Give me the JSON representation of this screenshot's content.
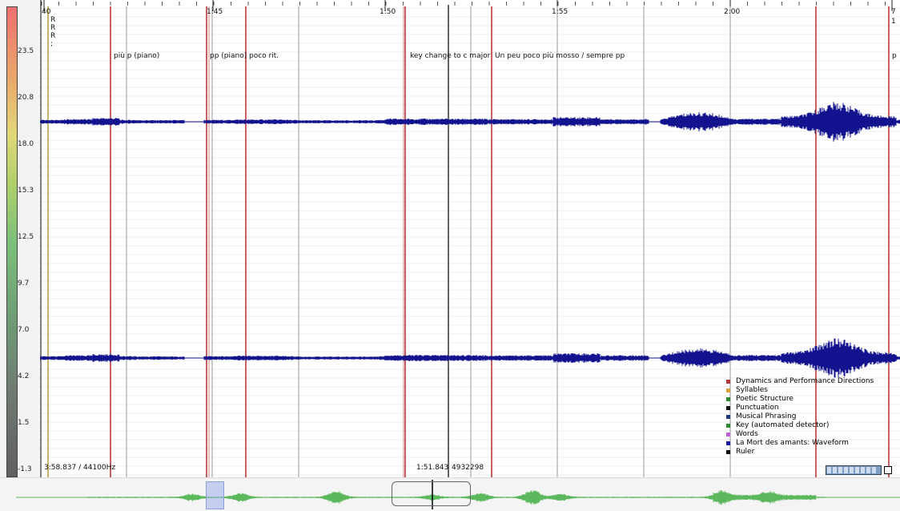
{
  "color_scale": {
    "labels": [
      "23.5",
      "20.8",
      "18.0",
      "15.3",
      "12.5",
      "9.7",
      "7.0",
      "4.2",
      "1.5",
      "-1.3"
    ]
  },
  "ruler": {
    "ticks": [
      "40",
      "1:45",
      "1:50",
      "1:55",
      "2:00",
      "7"
    ],
    "edge_sub_label": "1"
  },
  "annotations": {
    "r_marks": "R\nR\nR\n;",
    "labels": [
      "più p (piano)",
      "pp (piano)",
      "poco rit.",
      "key change to c major",
      "Un peu poco più mosso / sempre pp",
      "p"
    ]
  },
  "status": {
    "duration": "3:58.837 / 44100Hz",
    "cursor_time": "1:51.843",
    "cursor_frame": "4932298"
  },
  "legend": {
    "items": [
      {
        "label": "Dynamics and Performance Directions",
        "color": "#b03a3a"
      },
      {
        "label": "Syllables",
        "color": "#d9a03a"
      },
      {
        "label": "Poetic Structure",
        "color": "#2e8b2e"
      },
      {
        "label": "Punctuation",
        "color": "#111111"
      },
      {
        "label": "Musical Phrasing",
        "color": "#1f3a7a"
      },
      {
        "label": "Key (automated detector)",
        "color": "#2e8b2e"
      },
      {
        "label": "Words",
        "color": "#c060d0"
      },
      {
        "label": "La Mort des amants: Waveform",
        "color": "#1a1aa0"
      },
      {
        "label": "Ruler",
        "color": "#111111"
      }
    ]
  },
  "colors": {
    "waveform": "#13138f",
    "overview_waveform": "#5cb85c",
    "dynamics_line": "#b83a3a",
    "phrase_line": "#9a9a9a",
    "cursor_line": "#000000"
  }
}
